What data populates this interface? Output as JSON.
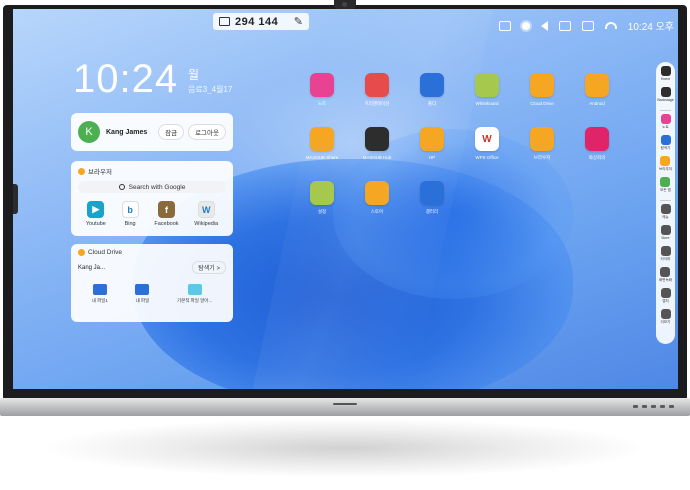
{
  "topbar": {
    "code": "294 144"
  },
  "status": {
    "time": "10:24 오후"
  },
  "clock": {
    "time": "10:24",
    "day": "월",
    "date": "음료3_4월17"
  },
  "user_card": {
    "initial": "K",
    "name": "Kang James",
    "btn1": "잠금",
    "btn2": "로그아웃"
  },
  "browser_card": {
    "title": "브라우저",
    "search_placeholder": "Search with Google",
    "shortcuts": [
      {
        "label": "Youtube",
        "glyph": "▶",
        "color": "#1aa3c9"
      },
      {
        "label": "Bing",
        "glyph": "b",
        "color": "#ffffff"
      },
      {
        "label": "Facebook",
        "glyph": "f",
        "color": "#8a6a3c"
      },
      {
        "label": "Wikipedia",
        "glyph": "W",
        "color": "#e9e9e9"
      }
    ]
  },
  "cloud_card": {
    "title": "Cloud Drive",
    "account": "Kang Ja...",
    "more": "탐색기 >",
    "files": [
      {
        "label": "내 파일1"
      },
      {
        "label": "내 파일"
      },
      {
        "label": "기본적 파일 알아..."
      }
    ]
  },
  "apps": [
    {
      "label": "노트",
      "color": "#e84393",
      "icon": "chart-icon"
    },
    {
      "label": "프리젠테이션",
      "color": "#e84b4b",
      "icon": "presentation-icon"
    },
    {
      "label": "폴더",
      "color": "#2b6fd8",
      "icon": "folder-icon"
    },
    {
      "label": "Whiteboard",
      "color": "#a6c84c",
      "icon": "user-icon"
    },
    {
      "label": "Cloud Drive",
      "color": "#f5a623",
      "icon": "cloud-icon"
    },
    {
      "label": "Android",
      "color": "#f5a623",
      "icon": "rocket-icon"
    },
    {
      "label": "MAXHUB Share",
      "color": "#f5a623",
      "icon": "cast-icon"
    },
    {
      "label": "MAXHUB Hub",
      "color": "#2d2d2d",
      "icon": "hub-icon"
    },
    {
      "label": "HP",
      "color": "#f5a623",
      "icon": "screen-icon"
    },
    {
      "label": "WPS Office",
      "color": "#ffffff",
      "icon": "wps-icon"
    },
    {
      "label": "브라우저",
      "color": "#f5a623",
      "icon": "browser-icon"
    },
    {
      "label": "화상회의",
      "color": "#e0246a",
      "icon": "video-icon"
    },
    {
      "label": "설정",
      "color": "#a6c84c",
      "icon": "gear-icon"
    },
    {
      "label": "스토어",
      "color": "#f5a623",
      "icon": "store-icon"
    },
    {
      "label": "갤러리",
      "color": "#2b6fd8",
      "icon": "palette-icon"
    }
  ],
  "dock": [
    {
      "label": "Home",
      "color": "#2d2d2d"
    },
    {
      "label": "Backstage",
      "color": "#2d2d2d"
    },
    {
      "label": "노트",
      "color": "#e84393"
    },
    {
      "label": "탐색기",
      "color": "#2b6fd8"
    },
    {
      "label": "브라우저",
      "color": "#f5a623"
    },
    {
      "label": "모든 앱",
      "color": "#4caf50"
    },
    {
      "label": "메뉴",
      "color": "#555555"
    },
    {
      "label": "More",
      "color": "#555555"
    },
    {
      "label": "타이머",
      "color": "#555555"
    },
    {
      "label": "화면녹화",
      "color": "#555555"
    },
    {
      "label": "캡처",
      "color": "#555555"
    },
    {
      "label": "더보기",
      "color": "#555555"
    }
  ]
}
